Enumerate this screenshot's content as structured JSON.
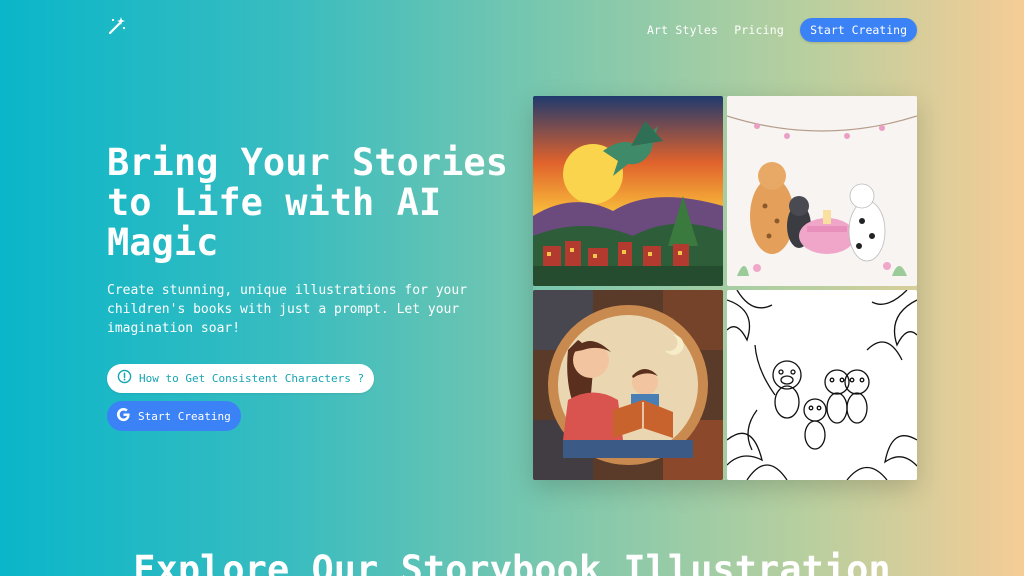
{
  "nav": {
    "logo_icon": "magic-wand-icon",
    "links": [
      "Art Styles",
      "Pricing"
    ],
    "cta_label": "Start Creating"
  },
  "hero": {
    "title": "Bring Your Stories to Life with AI Magic",
    "subtitle": "Create stunning, unique illustrations for your children's books with just a prompt. Let your imagination soar!",
    "howto_label": "How to Get Consistent Characters ?",
    "howto_icon": "info-circle-icon",
    "start_label": "Start Creating",
    "start_icon": "google-icon"
  },
  "gallery": {
    "images": [
      "dragon-sunset-village-image",
      "animals-tea-party-image",
      "mother-child-reading-image",
      "monkeys-coloring-page-image"
    ]
  },
  "section": {
    "title": "Explore Our Storybook Illustration"
  },
  "colors": {
    "accent": "#3b82f6",
    "teal_text": "#16a5b3"
  }
}
